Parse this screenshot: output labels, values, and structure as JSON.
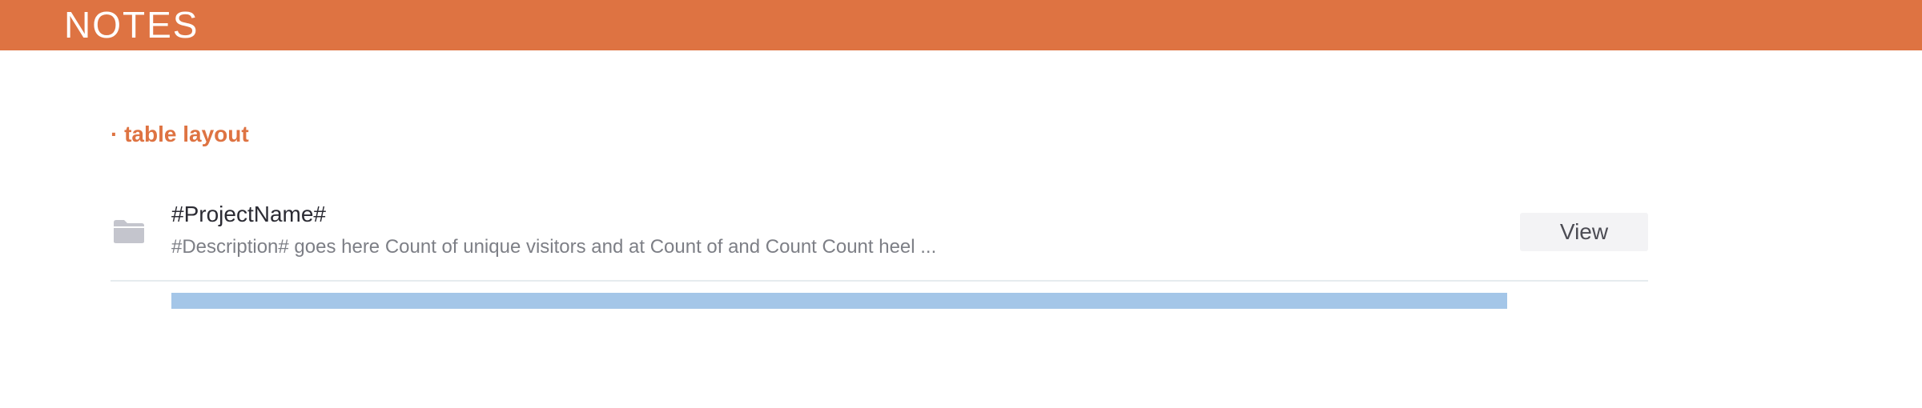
{
  "header": {
    "title": "NOTES",
    "background": "#de7342"
  },
  "section": {
    "heading": "· table layout",
    "accent": "#de7342"
  },
  "project": {
    "icon": "folder-icon",
    "name": "#ProjectName#",
    "description": "#Description# goes here Count of unique visitors and at Count of and Count Count heel ...",
    "view_label": "View",
    "progress": 1.0,
    "progress_color": "#a4c6e8"
  }
}
